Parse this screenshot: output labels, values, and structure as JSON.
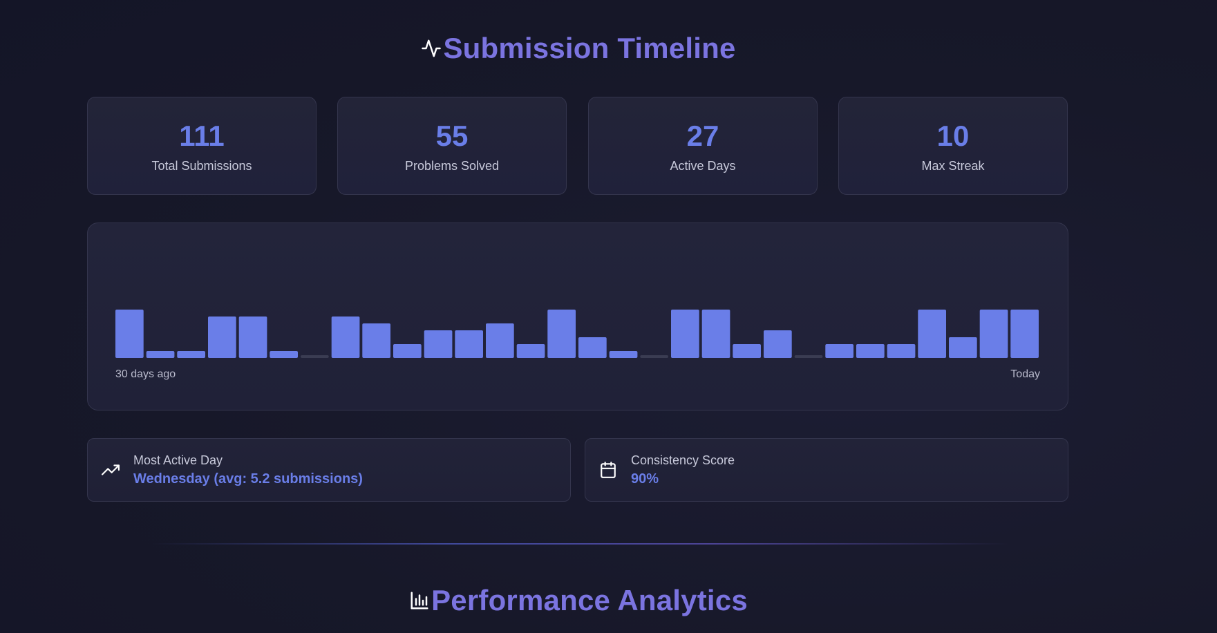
{
  "timeline": {
    "title": "Submission Timeline",
    "icon": "activity-icon"
  },
  "stats": [
    {
      "value": "111",
      "label": "Total Submissions"
    },
    {
      "value": "55",
      "label": "Problems Solved"
    },
    {
      "value": "27",
      "label": "Active Days"
    },
    {
      "value": "10",
      "label": "Max Streak"
    }
  ],
  "chart_data": {
    "type": "bar",
    "values": [
      7,
      1,
      1,
      6,
      6,
      1,
      0,
      6,
      5,
      2,
      4,
      4,
      5,
      2,
      7,
      3,
      1,
      0,
      7,
      7,
      2,
      4,
      0,
      2,
      2,
      2,
      7,
      3,
      7,
      7
    ],
    "bar_color": "#6a7ee8",
    "empty_color": "#3a3c52",
    "start_label": "30 days ago",
    "end_label": "Today"
  },
  "insights": {
    "most_active": {
      "label": "Most Active Day",
      "value": "Wednesday (avg: 5.2 submissions)",
      "icon": "trending-up-icon"
    },
    "consistency": {
      "label": "Consistency Score",
      "value": "90%",
      "icon": "calendar-icon"
    }
  },
  "analytics": {
    "title": "Performance Analytics",
    "icon": "bar-chart-icon"
  },
  "colors": {
    "accent": "#6a7ee8",
    "title": "#7b74e0",
    "background": "#161729"
  }
}
